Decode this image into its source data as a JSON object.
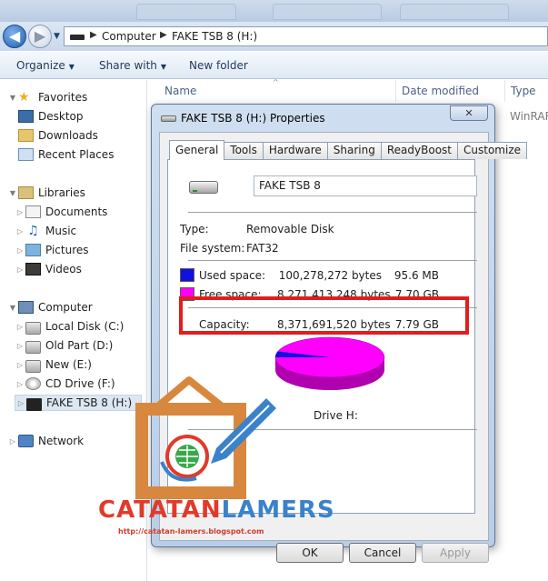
{
  "explorer": {
    "address": {
      "crumbs": [
        "Computer",
        "FAKE TSB 8 (H:)"
      ]
    },
    "toolbar": {
      "organize": "Organize",
      "share_with": "Share with",
      "new_folder": "New folder"
    },
    "columns": {
      "name": "Name",
      "date_modified": "Date modified",
      "type": "Type"
    },
    "visible_row_type": "WinRAR",
    "nav": {
      "favorites": "Favorites",
      "favorites_items": [
        "Desktop",
        "Downloads",
        "Recent Places"
      ],
      "libraries": "Libraries",
      "libraries_items": [
        "Documents",
        "Music",
        "Pictures",
        "Videos"
      ],
      "computer": "Computer",
      "computer_items": [
        "Local Disk (C:)",
        "Old Part (D:)",
        "New (E:)",
        "CD Drive (F:)",
        "FAKE TSB 8 (H:)"
      ],
      "network": "Network"
    }
  },
  "dialog": {
    "title": "FAKE TSB 8 (H:) Properties",
    "close_symbol": "✕",
    "tabs": [
      "General",
      "Tools",
      "Hardware",
      "Sharing",
      "ReadyBoost",
      "Customize"
    ],
    "active_tab": "General",
    "drive_name": "FAKE TSB 8",
    "type_label": "Type:",
    "type_value": "Removable Disk",
    "fs_label": "File system:",
    "fs_value": "FAT32",
    "used_label": "Used space:",
    "used_bytes": "100,278,272 bytes",
    "used_human": "95.6 MB",
    "free_label": "Free space:",
    "free_bytes": "8,271,413,248 bytes",
    "free_human": "7.70 GB",
    "capacity_label": "Capacity:",
    "capacity_bytes": "8,371,691,520 bytes",
    "capacity_human": "7.79 GB",
    "drive_caption": "Drive H:",
    "buttons": {
      "ok": "OK",
      "cancel": "Cancel",
      "apply": "Apply"
    },
    "colors": {
      "used": "#1010e0",
      "free": "#ff00ff"
    },
    "used_fraction": 0.012
  },
  "watermark": {
    "brand_part1": "CATATAN",
    "brand_part2": "LAMERS",
    "url": "http://catatan-lamers.blogspot.com",
    "colors": {
      "brand_part1": "#e03a2a",
      "brand_part2": "#3a82c9",
      "frame": "#d8873e"
    }
  }
}
